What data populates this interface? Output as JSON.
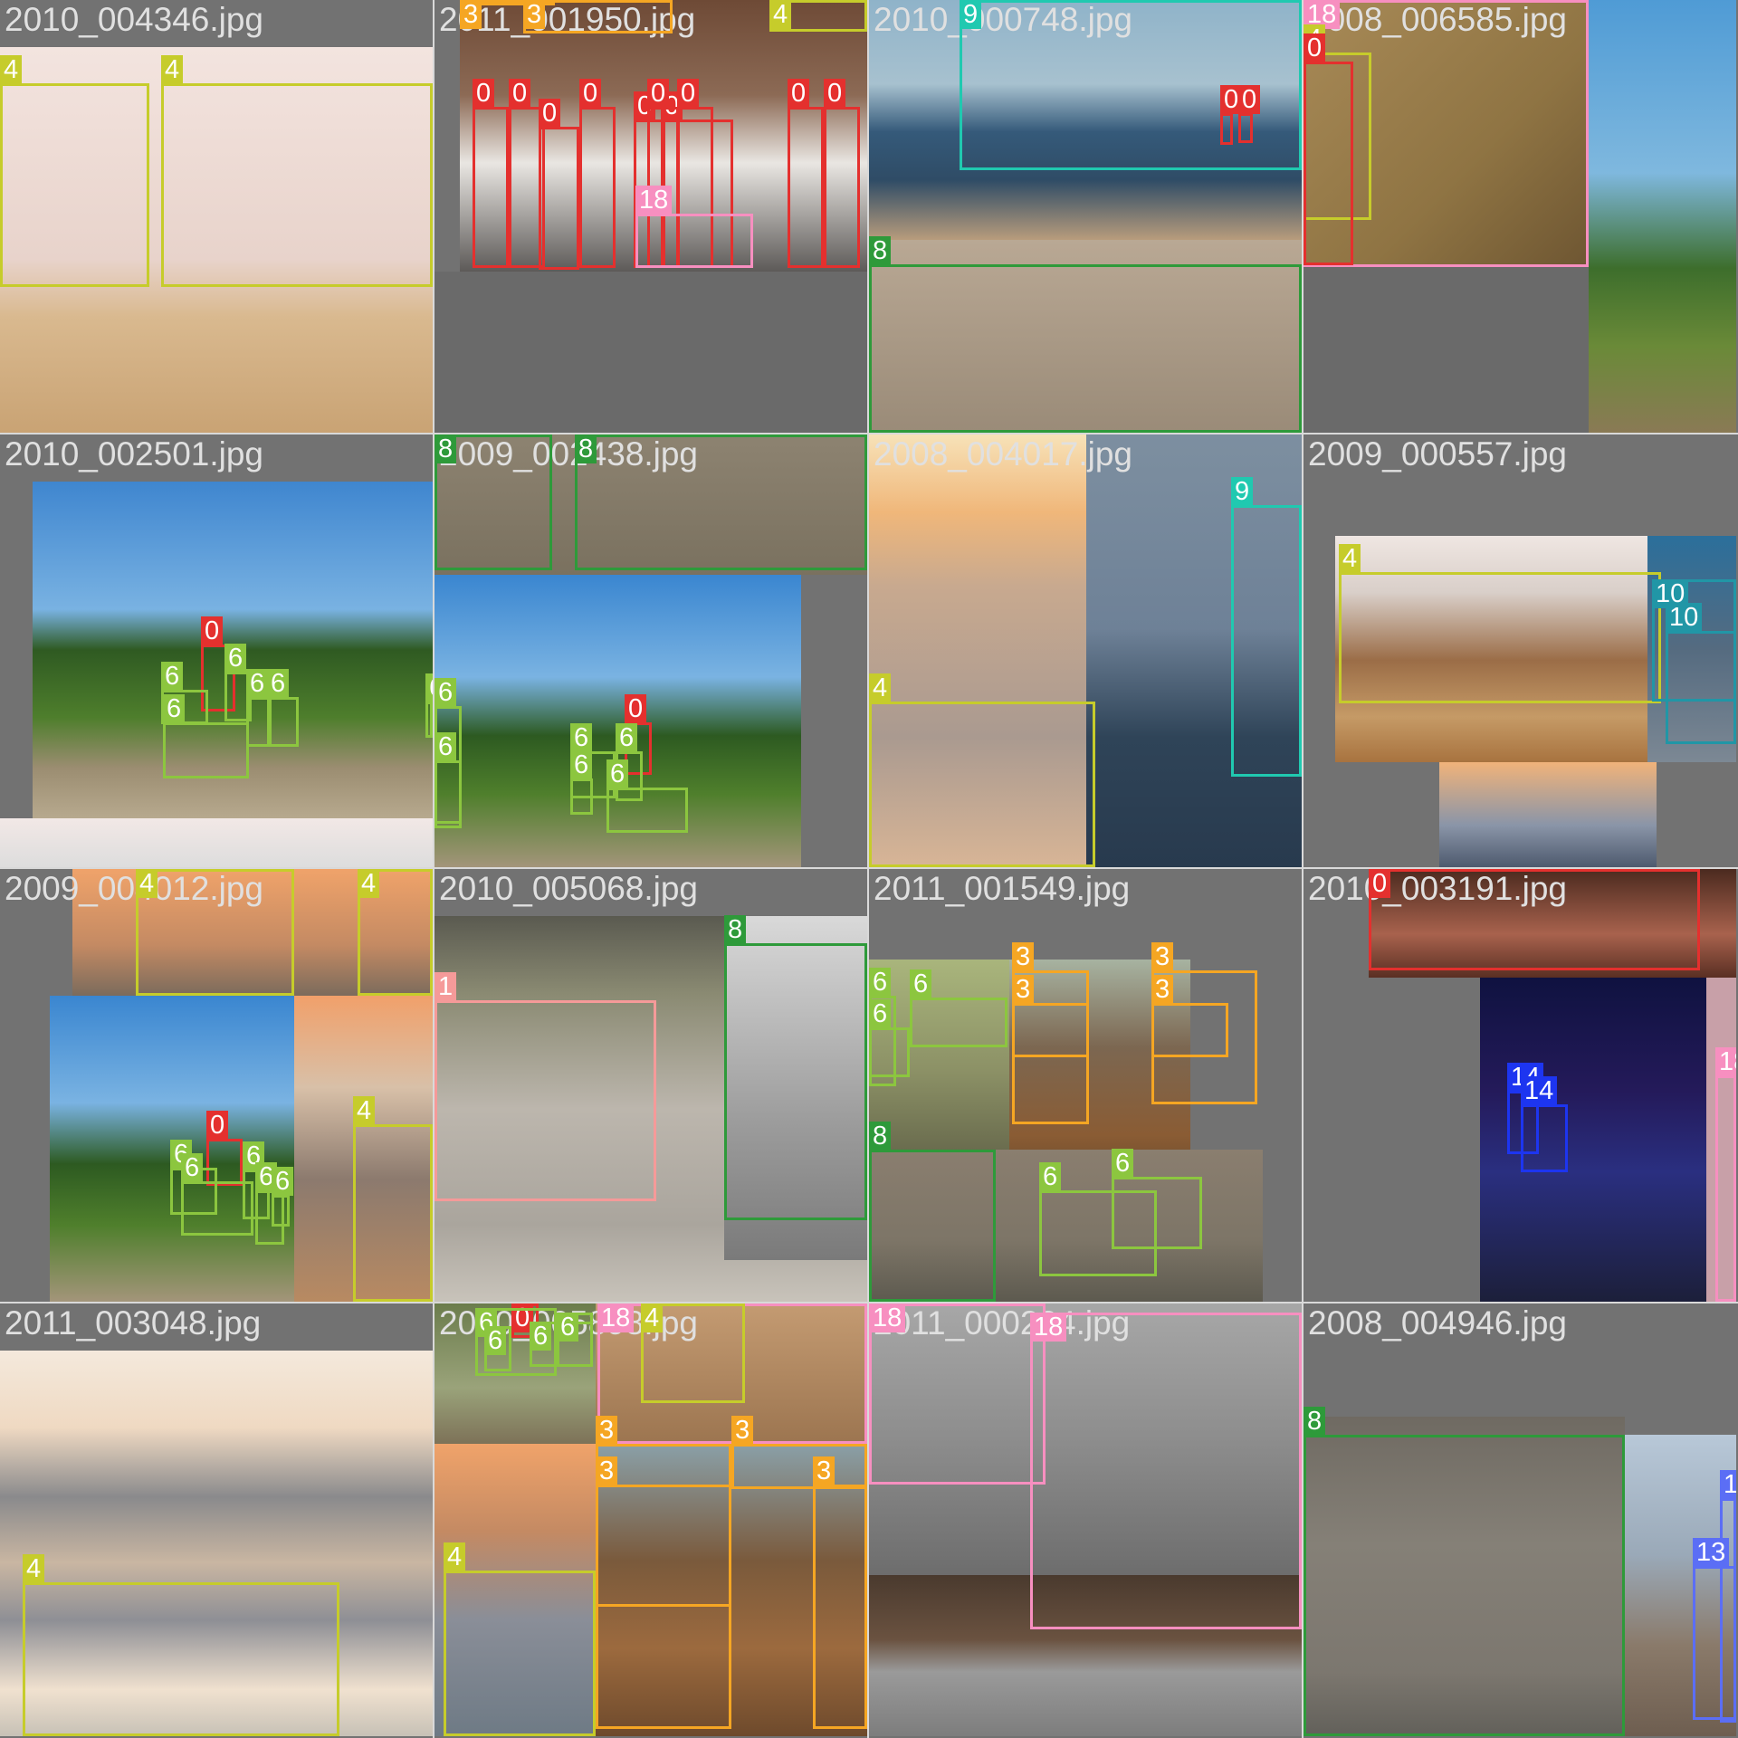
{
  "class_colors": {
    "0": "#e4302e",
    "1": "#f59a99",
    "3": "#f5a623",
    "4": "#c6cc2b",
    "6": "#8cc63f",
    "8": "#2e9a3a",
    "9": "#20c9b0",
    "10": "#2196a6",
    "13": "#5b6ef5",
    "14": "#1d35f0",
    "18": "#f78fc0"
  },
  "tiles": [
    {
      "filename": "2010_004346.jpg"
    },
    {
      "filename": "2011_001950.jpg"
    },
    {
      "filename": "2010_000748.jpg"
    },
    {
      "filename": "2008_006585.jpg"
    },
    {
      "filename": "2010_002501.jpg"
    },
    {
      "filename": "2009_002438.jpg"
    },
    {
      "filename": "2008_004017.jpg"
    },
    {
      "filename": "2009_000557.jpg"
    },
    {
      "filename": "2009_004012.jpg"
    },
    {
      "filename": "2010_005068.jpg"
    },
    {
      "filename": "2011_001549.jpg"
    },
    {
      "filename": "2010_003191.jpg"
    },
    {
      "filename": "2011_003048.jpg"
    },
    {
      "filename": "2010_005898.jpg"
    },
    {
      "filename": "2011_000224.jpg"
    },
    {
      "filename": "2008_004946.jpg"
    }
  ]
}
